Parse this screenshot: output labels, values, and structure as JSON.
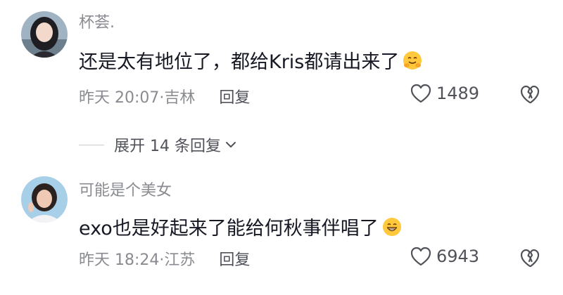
{
  "comments": [
    {
      "username": "杯荟.",
      "text": "还是太有地位了，都给Kris都请出来了",
      "emoji": "hug-face-emoji",
      "time_location": "昨天 20:07·吉林",
      "reply_label": "回复",
      "likes": "1489"
    },
    {
      "username": "可能是个美女",
      "text": "exo也是好起来了能给何秋事伴唱了",
      "emoji": "grin-face-emoji",
      "time_location": "昨天 18:24·江苏",
      "reply_label": "回复",
      "likes": "6943"
    }
  ],
  "expand_replies": {
    "label": "展开 14 条回复"
  },
  "colors": {
    "text_primary": "#161823",
    "text_secondary": "#8a8b91",
    "icon": "#505259",
    "emoji_yellow": "#ffc83d"
  }
}
